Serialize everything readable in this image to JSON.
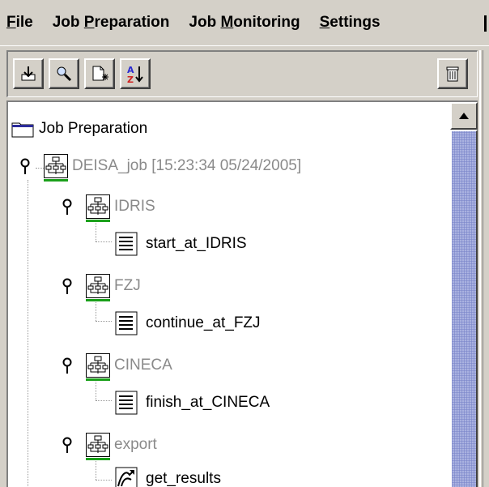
{
  "menu": {
    "items": [
      {
        "pre": "",
        "u": "F",
        "post": "ile"
      },
      {
        "pre": "Job ",
        "u": "P",
        "post": "reparation"
      },
      {
        "pre": "Job ",
        "u": "M",
        "post": "onitoring"
      },
      {
        "pre": "",
        "u": "S",
        "post": "ettings"
      }
    ]
  },
  "toolbar": {
    "icons": [
      "export-icon",
      "search-icon",
      "new-document-icon",
      "sort-az-icon",
      "trash-icon"
    ]
  },
  "tree": {
    "root_label": "Job Preparation",
    "job_label": "DEISA_job [15:23:34 05/24/2005]",
    "sites": [
      {
        "label": "IDRIS",
        "task": "start_at_IDRIS"
      },
      {
        "label": "FZJ",
        "task": "continue_at_FZJ"
      },
      {
        "label": "CINECA",
        "task": "finish_at_CINECA"
      },
      {
        "label": "export",
        "task": "get_results"
      }
    ]
  },
  "colors": {
    "window_bg": "#d4d0c8",
    "disabled_text": "#8a8a8a",
    "status_green": "#1aa01a",
    "scroll_thumb": "#aab2e0"
  }
}
